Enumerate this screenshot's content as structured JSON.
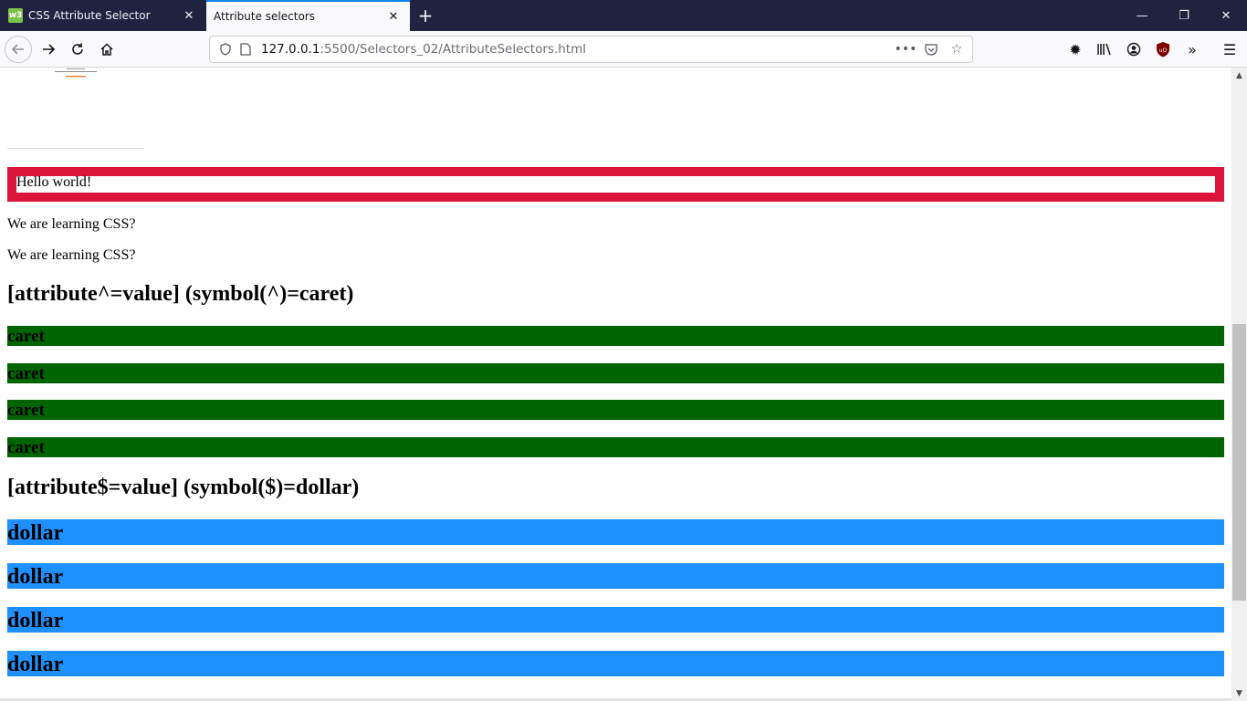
{
  "browser": {
    "tabs": [
      {
        "title": "CSS Attribute Selector",
        "favicon": "w3",
        "active": false
      },
      {
        "title": "Attribute selectors",
        "active": true
      }
    ],
    "url_host": "127.0.0.1",
    "url_path": ":5500/Selectors_02/AttributeSelectors.html",
    "window_controls": [
      "minimize",
      "restore",
      "close"
    ]
  },
  "page": {
    "hello_text": "Hello world!",
    "paragraphs": [
      "We are learning CSS?",
      "We are learning CSS?"
    ],
    "caret_heading": "[attribute^=value] (symbol(^)=caret)",
    "caret_items": [
      "caret",
      "caret",
      "caret",
      "caret"
    ],
    "dollar_heading": "[attribute$=value] (symbol($)=dollar)",
    "dollar_items": [
      "dollar",
      "dollar",
      "dollar",
      "dollar"
    ]
  },
  "colors": {
    "tabbar_bg": "#202340",
    "hello_border": "#dc143c",
    "caret_bg": "#006400",
    "dollar_bg": "#1e90ff",
    "tab_accent": "#0a84ff"
  }
}
